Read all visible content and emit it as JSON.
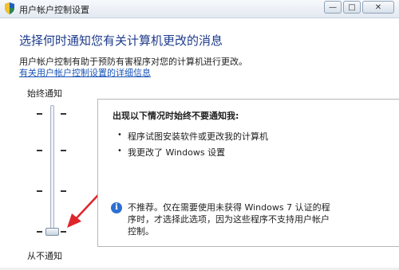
{
  "window": {
    "title": "用户帐户控制设置",
    "minimize_glyph": "—",
    "maximize_glyph": "□",
    "close_glyph": "✕"
  },
  "main": {
    "heading": "选择何时通知您有关计算机更改的消息",
    "description": "用户帐户控制有助于预防有害程序对您的计算机进行更改。",
    "more_link": "有关用户帐户控制设置的详细信息"
  },
  "slider": {
    "top_label": "始终通知",
    "bottom_label": "从不通知",
    "levels": 4,
    "selected_level": 0
  },
  "panel": {
    "title": "出现以下情况时始终不要通知我:",
    "items": [
      "程序试图安装软件或更改我的计算机",
      "我更改了 Windows 设置"
    ],
    "bullet": "•",
    "info_glyph": "i",
    "note": "不推荐。仅在需要使用未获得 Windows 7 认证的程序时，才选择此选项，因为这些程序不支持用户帐户控制。"
  },
  "colors": {
    "heading": "#1e3b8c",
    "link": "#1a55b8",
    "annotation_arrow": "#e0242b"
  }
}
